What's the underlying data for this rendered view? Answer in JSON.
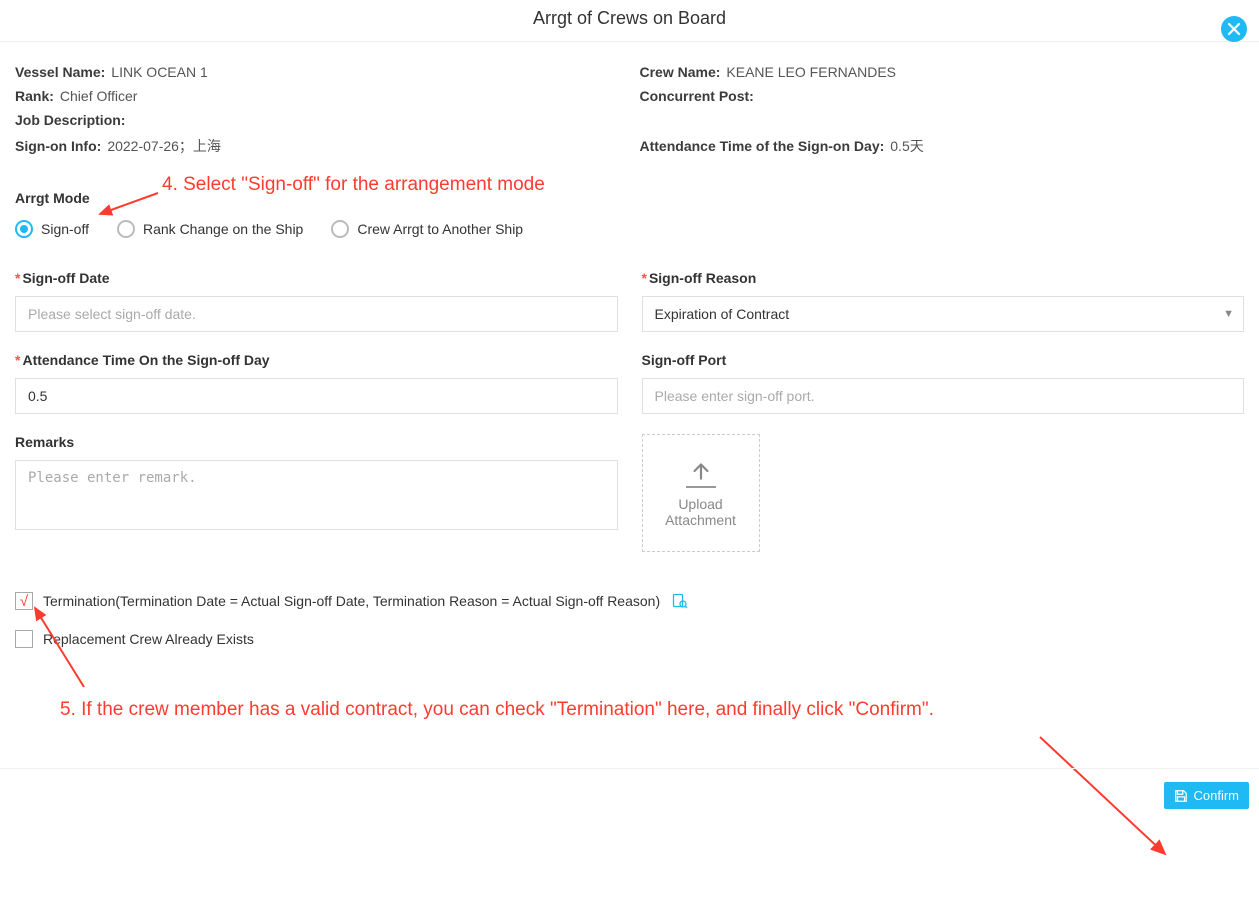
{
  "header": {
    "title": "Arrgt of Crews on Board"
  },
  "info": {
    "vessel_name_label": "Vessel Name:",
    "vessel_name": "LINK OCEAN 1",
    "crew_name_label": "Crew Name:",
    "crew_name": "KEANE LEO FERNANDES",
    "rank_label": "Rank:",
    "rank": "Chief Officer",
    "concurrent_label": "Concurrent Post:",
    "concurrent": "",
    "job_desc_label": "Job Description:",
    "job_desc": "",
    "signon_label": "Sign-on Info:",
    "signon": "2022-07-26；上海",
    "att_day_label": "Attendance Time of the Sign-on Day:",
    "att_day": "0.5天"
  },
  "arrgt": {
    "section_label": "Arrgt Mode",
    "opt1": "Sign-off",
    "opt2": "Rank Change on the Ship",
    "opt3": "Crew Arrgt to Another Ship"
  },
  "form": {
    "signoff_date_label": "Sign-off Date",
    "signoff_date_ph": "Please select sign-off date.",
    "signoff_reason_label": "Sign-off Reason",
    "signoff_reason_val": "Expiration of Contract",
    "att_time_label": "Attendance Time On the Sign-off Day",
    "att_time_val": "0.5",
    "signoff_port_label": "Sign-off Port",
    "signoff_port_ph": "Please enter sign-off port.",
    "remarks_label": "Remarks",
    "remarks_ph": "Please enter remark.",
    "upload_l1": "Upload",
    "upload_l2": "Attachment"
  },
  "checks": {
    "termination": "Termination(Termination Date = Actual Sign-off Date, Termination Reason = Actual Sign-off Reason)",
    "replacement": "Replacement Crew Already Exists"
  },
  "annotations": {
    "a4": "4. Select \"Sign-off\" for the arrangement mode",
    "a5": "5. If the crew member has a valid contract, you can check \"Termination\" here, and finally click \"Confirm\"."
  },
  "footer": {
    "confirm": "Confirm"
  }
}
